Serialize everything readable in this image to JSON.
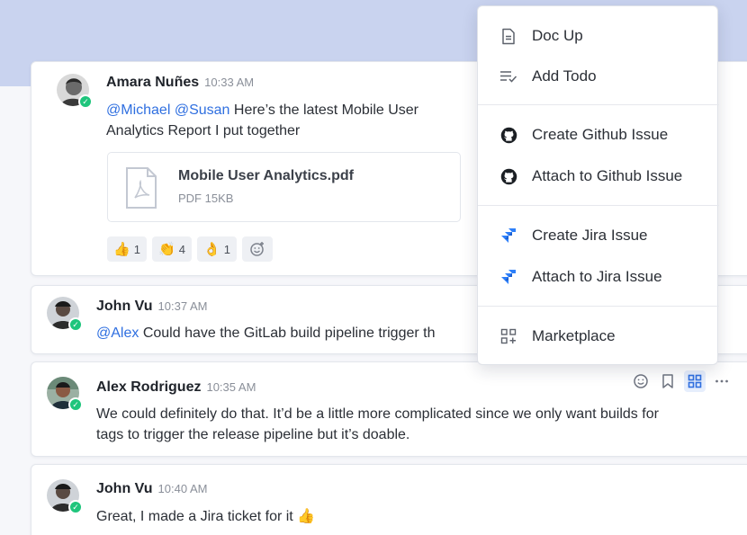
{
  "messages": [
    {
      "author": "Amara Nuñes",
      "time": "10:33 AM",
      "mentions": "@Michael @Susan",
      "text_line1": " Here’s the latest Mobile User",
      "text_line2": "Analytics Report I put together",
      "attachment": {
        "name": "Mobile User Analytics.pdf",
        "meta": "PDF 15KB"
      },
      "reactions": [
        {
          "emoji": "👍",
          "count": "1"
        },
        {
          "emoji": "👏",
          "count": "4"
        },
        {
          "emoji": "👌",
          "count": "1"
        }
      ]
    },
    {
      "author": "John Vu",
      "time": "10:37 AM",
      "mention": "@Alex",
      "text": " Could have the GitLab build pipeline trigger th"
    },
    {
      "author": "Alex Rodriguez",
      "time": "10:35 AM",
      "text_line1": "We could definitely do that. It’d be a little more complicated since we only want builds for",
      "text_line2": "tags to trigger the release pipeline but it’s doable."
    },
    {
      "author": "John Vu",
      "time": "10:40 AM",
      "text": "Great, I made a Jira ticket for it",
      "emoji": "👍"
    }
  ],
  "menu": {
    "items": [
      {
        "label": "Doc Up",
        "icon": "document-icon"
      },
      {
        "label": "Add Todo",
        "icon": "todo-icon"
      },
      {
        "label": "Create Github Issue",
        "icon": "github-icon"
      },
      {
        "label": "Attach to Github Issue",
        "icon": "github-icon"
      },
      {
        "label": "Create Jira Issue",
        "icon": "jira-icon"
      },
      {
        "label": "Attach to Jira Issue",
        "icon": "jira-icon"
      },
      {
        "label": "Marketplace",
        "icon": "marketplace-icon"
      }
    ]
  },
  "colors": {
    "top_band": "#c9d3ef",
    "mention": "#2f6fe0",
    "online": "#1fc57c",
    "jira": "#2d7ff9",
    "active_tool": "#2f6fe0"
  }
}
